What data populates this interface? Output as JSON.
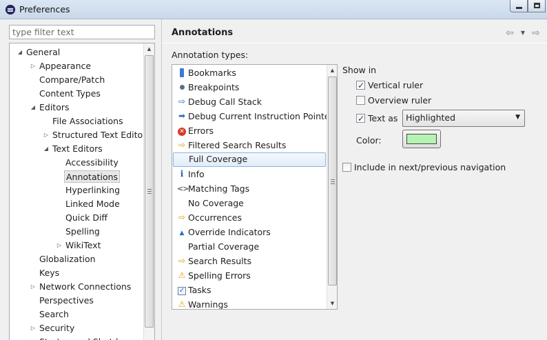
{
  "window": {
    "title": "Preferences"
  },
  "filter": {
    "placeholder": "type filter text"
  },
  "tree": [
    {
      "label": "General",
      "indent": 0,
      "arrow": "open"
    },
    {
      "label": "Appearance",
      "indent": 1,
      "arrow": "closed"
    },
    {
      "label": "Compare/Patch",
      "indent": 1,
      "arrow": "none"
    },
    {
      "label": "Content Types",
      "indent": 1,
      "arrow": "none"
    },
    {
      "label": "Editors",
      "indent": 1,
      "arrow": "open"
    },
    {
      "label": "File Associations",
      "indent": 2,
      "arrow": "none"
    },
    {
      "label": "Structured Text Editors",
      "indent": 2,
      "arrow": "closed"
    },
    {
      "label": "Text Editors",
      "indent": 2,
      "arrow": "open"
    },
    {
      "label": "Accessibility",
      "indent": 3,
      "arrow": "none"
    },
    {
      "label": "Annotations",
      "indent": 3,
      "arrow": "none",
      "selected": true
    },
    {
      "label": "Hyperlinking",
      "indent": 3,
      "arrow": "none"
    },
    {
      "label": "Linked Mode",
      "indent": 3,
      "arrow": "none"
    },
    {
      "label": "Quick Diff",
      "indent": 3,
      "arrow": "none"
    },
    {
      "label": "Spelling",
      "indent": 3,
      "arrow": "none"
    },
    {
      "label": "WikiText",
      "indent": 3,
      "arrow": "closed"
    },
    {
      "label": "Globalization",
      "indent": 1,
      "arrow": "none"
    },
    {
      "label": "Keys",
      "indent": 1,
      "arrow": "none"
    },
    {
      "label": "Network Connections",
      "indent": 1,
      "arrow": "closed"
    },
    {
      "label": "Perspectives",
      "indent": 1,
      "arrow": "none"
    },
    {
      "label": "Search",
      "indent": 1,
      "arrow": "none"
    },
    {
      "label": "Security",
      "indent": 1,
      "arrow": "closed"
    },
    {
      "label": "Startup and Shutdown",
      "indent": 1,
      "arrow": "closed"
    }
  ],
  "page": {
    "title": "Annotations",
    "types_label": "Annotation types:",
    "types": [
      {
        "label": "Bookmarks",
        "icon": "bookmark-icon"
      },
      {
        "label": "Breakpoints",
        "icon": "breakpoint-icon"
      },
      {
        "label": "Debug Call Stack",
        "icon": "debug-arrow-icon"
      },
      {
        "label": "Debug Current Instruction Pointer",
        "icon": "debug-pointer-icon"
      },
      {
        "label": "Errors",
        "icon": "error-icon"
      },
      {
        "label": "Filtered Search Results",
        "icon": "search-arrow-icon"
      },
      {
        "label": "Full Coverage",
        "icon": "",
        "selected": true
      },
      {
        "label": "Info",
        "icon": "info-icon"
      },
      {
        "label": "Matching Tags",
        "icon": "tag-icon"
      },
      {
        "label": "No Coverage",
        "icon": ""
      },
      {
        "label": "Occurrences",
        "icon": "search-arrow-icon"
      },
      {
        "label": "Override Indicators",
        "icon": "override-icon"
      },
      {
        "label": "Partial Coverage",
        "icon": ""
      },
      {
        "label": "Search Results",
        "icon": "search-arrow-icon"
      },
      {
        "label": "Spelling Errors",
        "icon": "warning-icon"
      },
      {
        "label": "Tasks",
        "icon": "tasks-icon"
      },
      {
        "label": "Warnings",
        "icon": "warning-icon"
      }
    ],
    "show_in_label": "Show in",
    "vertical_ruler": {
      "label": "Vertical ruler",
      "checked": true
    },
    "overview_ruler": {
      "label": "Overview ruler",
      "checked": false
    },
    "text_as": {
      "label": "Text as",
      "checked": true,
      "value": "Highlighted"
    },
    "color_label": "Color:",
    "color_value": "#b5f3b5",
    "include_nav": {
      "label": "Include in next/previous navigation",
      "checked": false
    }
  }
}
